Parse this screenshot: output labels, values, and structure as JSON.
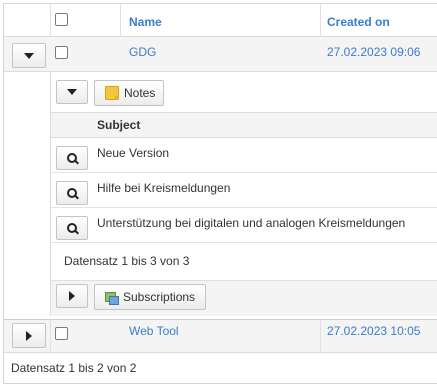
{
  "grid": {
    "columns": {
      "name": "Name",
      "created_on": "Created on"
    },
    "rows": [
      {
        "name": "GDG",
        "created_on": "27.02.2023 09:06",
        "expanded": true
      },
      {
        "name": "Web Tool",
        "created_on": "27.02.2023 10:05",
        "expanded": false
      }
    ],
    "footer": "Datensatz 1 bis 2 von 2"
  },
  "detail": {
    "notes_label": "Notes",
    "subject_header": "Subject",
    "subjects": [
      "Neue Version",
      "Hilfe bei Kreismeldungen",
      "Unterstützung bei digitalen und analogen Kreismeldungen"
    ],
    "footer": "Datensatz 1 bis 3 von 3",
    "subscriptions_label": "Subscriptions"
  },
  "icons": {
    "expand": "caret-down-icon",
    "collapse": "caret-right-icon",
    "view": "magnifier-icon",
    "notes": "note-icon",
    "subscriptions": "subscriptions-icon"
  },
  "colors": {
    "link": "#3d7cc9",
    "row_bg": "#f4f4f4",
    "border": "#dcdcdc"
  }
}
